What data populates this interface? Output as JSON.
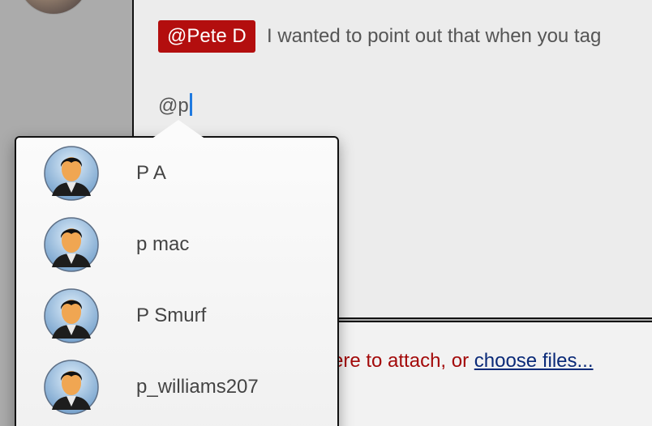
{
  "composer": {
    "mention_chip": "@Pete D",
    "message_text": "I wanted to point out that when you tag",
    "typed_text": "@p"
  },
  "attachments": {
    "drop_text": "ere to attach, or ",
    "choose_link": "choose files..."
  },
  "suggestions": {
    "items": [
      {
        "label": "P A",
        "icon": "user-avatar-icon"
      },
      {
        "label": "p mac",
        "icon": "user-avatar-icon"
      },
      {
        "label": "P Smurf",
        "icon": "user-avatar-icon"
      },
      {
        "label": "p_williams207",
        "icon": "user-avatar-icon"
      }
    ]
  },
  "colors": {
    "mention_chip_bg": "#b30e0e",
    "caret": "#1f7ae0",
    "drop_text": "#a30a0a",
    "link": "#0a2a78"
  }
}
